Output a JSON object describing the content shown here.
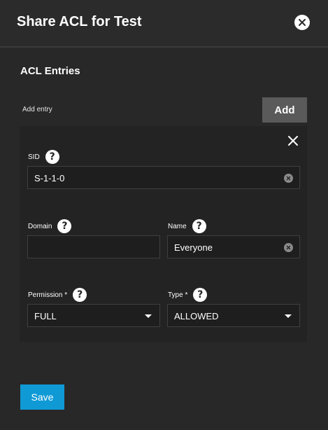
{
  "dialog": {
    "title": "Share ACL for Test"
  },
  "acl": {
    "section_title": "ACL Entries",
    "add_entry_label": "Add entry",
    "add_button": "Add"
  },
  "entry": {
    "sid": {
      "label": "SID",
      "value": "S-1-1-0"
    },
    "domain": {
      "label": "Domain",
      "value": ""
    },
    "name": {
      "label": "Name",
      "value": "Everyone"
    },
    "permission": {
      "label": "Permission *",
      "value": "FULL"
    },
    "type": {
      "label": "Type *",
      "value": "ALLOWED"
    }
  },
  "help_glyph": "?",
  "footer": {
    "save_button": "Save"
  },
  "colors": {
    "background": "#282828",
    "card": "#232323",
    "save_accent": "#0f9ad6",
    "add_button": "#5a5a5a"
  }
}
